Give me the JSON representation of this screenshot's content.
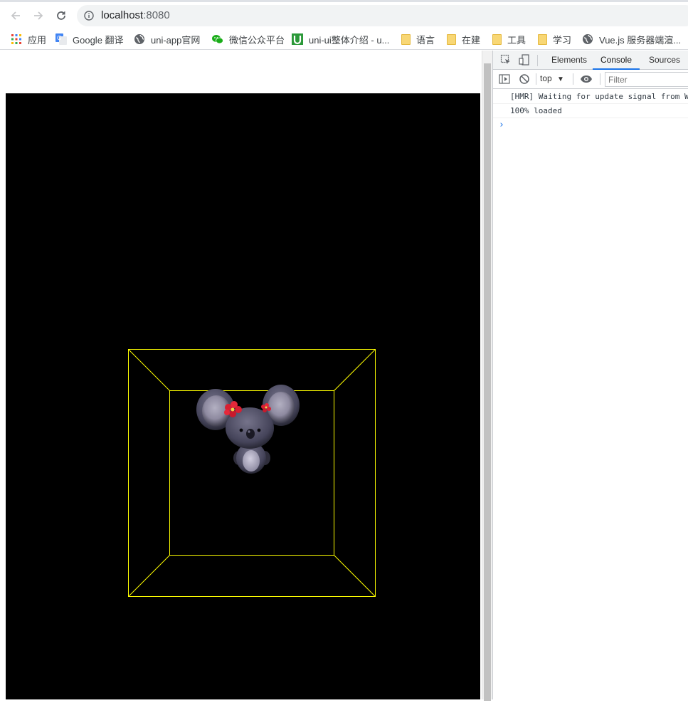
{
  "browser": {
    "url_host": "localhost",
    "url_port": ":8080"
  },
  "bookmarks": [
    {
      "label": "应用",
      "icon": "apps-grid-icon"
    },
    {
      "label": "Google 翻译",
      "icon": "google-translate-icon"
    },
    {
      "label": "uni-app官网",
      "icon": "globe-icon"
    },
    {
      "label": "微信公众平台",
      "icon": "wechat-icon"
    },
    {
      "label": "uni-ui整体介绍 - u...",
      "icon": "uni-icon"
    },
    {
      "label": "语言",
      "icon": "folder-icon"
    },
    {
      "label": "在建",
      "icon": "folder-icon"
    },
    {
      "label": "工具",
      "icon": "folder-icon"
    },
    {
      "label": "学习",
      "icon": "folder-icon"
    },
    {
      "label": "Vue.js 服务器端渲...",
      "icon": "globe-icon"
    }
  ],
  "devtools": {
    "tabs": [
      "Elements",
      "Console",
      "Sources"
    ],
    "active_tab": "Console",
    "context": "top",
    "filter_placeholder": "Filter",
    "console_lines": [
      "[HMR] Waiting for update signal from WDS...",
      "100% loaded"
    ],
    "prompt": "›"
  },
  "scene": {
    "box_color": "#ffff00",
    "background": "#000000",
    "model": "koala-mouse-3d-model"
  }
}
